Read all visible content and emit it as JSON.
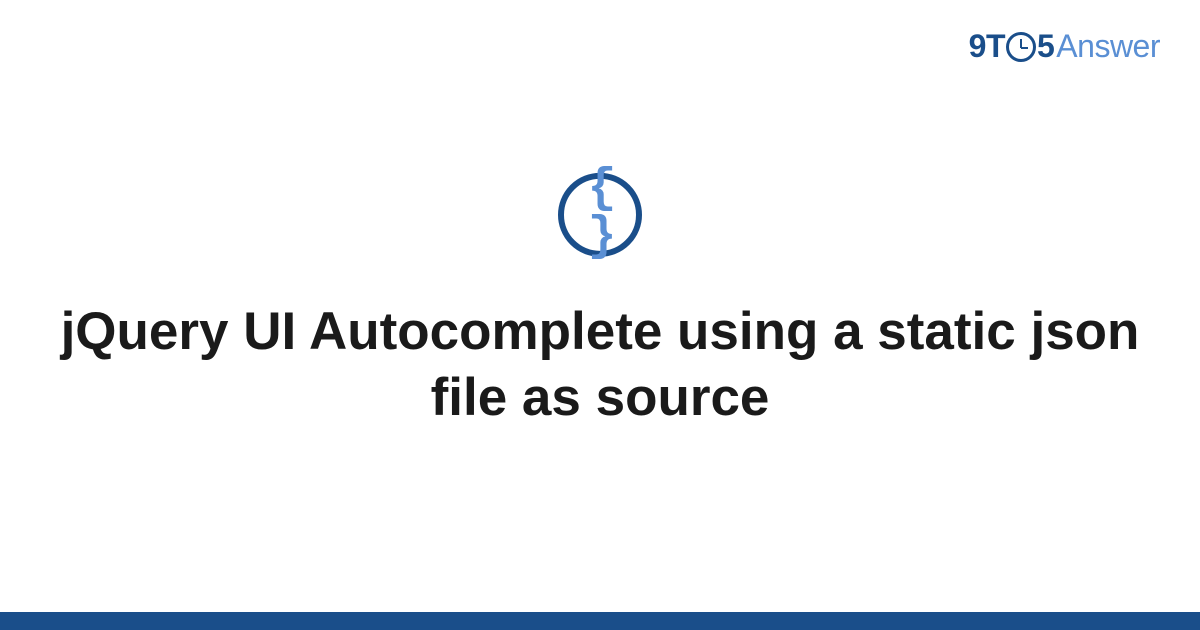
{
  "logo": {
    "part1": "9T",
    "part2": "5",
    "part3": "Answer"
  },
  "icon": {
    "glyph": "{ }"
  },
  "title": "jQuery UI Autocomplete using a static json file as source"
}
